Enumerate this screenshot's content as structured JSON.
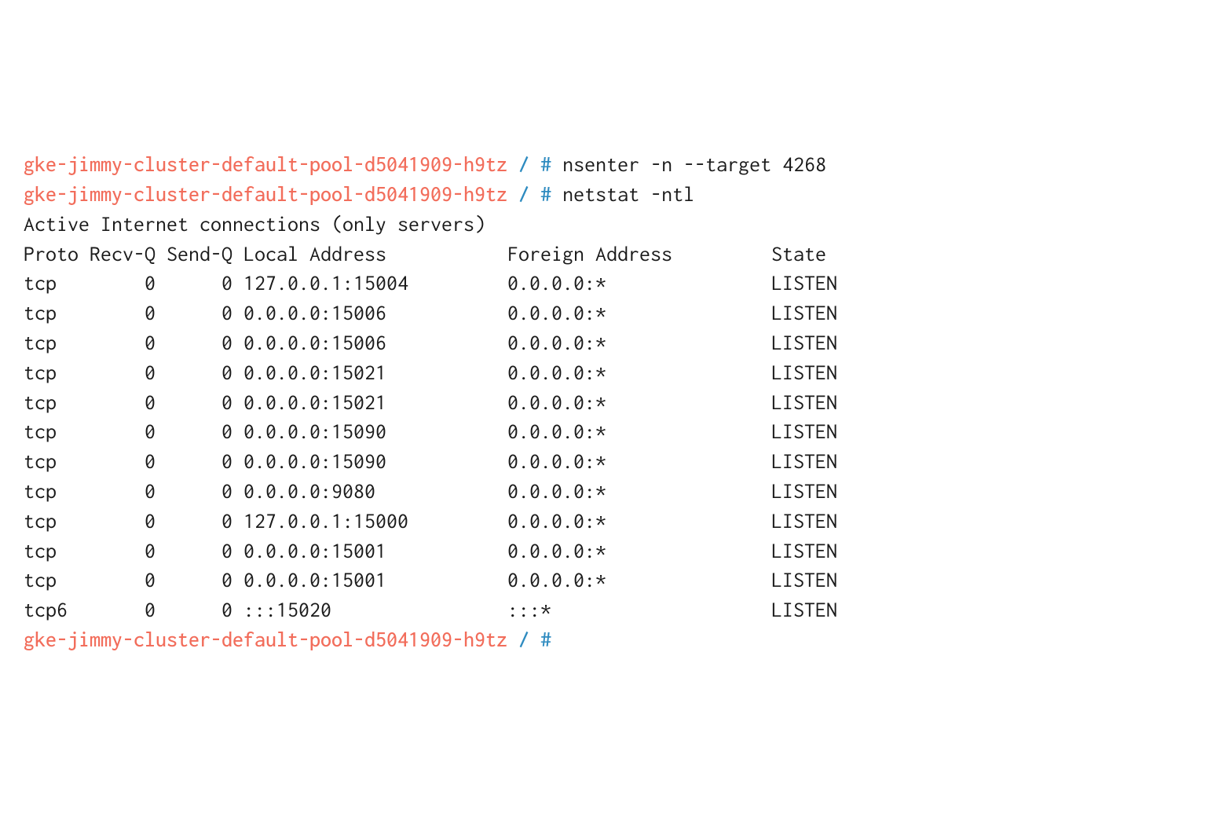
{
  "lines": [
    {
      "type": "prompt",
      "hostname": "gke-jimmy-cluster-default-pool-d5041909-h9tz",
      "path": "/",
      "hash": "#",
      "command": "nsenter -n --target 4268"
    },
    {
      "type": "prompt",
      "hostname": "gke-jimmy-cluster-default-pool-d5041909-h9tz",
      "path": "/",
      "hash": "#",
      "command": "netstat -ntl"
    },
    {
      "type": "output",
      "text": "Active Internet connections (only servers)"
    }
  ],
  "table": {
    "headers": [
      "Proto",
      "Recv-Q",
      "Send-Q",
      "Local Address",
      "Foreign Address",
      "State"
    ],
    "rows": [
      {
        "proto": "tcp",
        "recvq": "0",
        "sendq": "0",
        "local": "127.0.0.1:15004",
        "foreign": "0.0.0.0:*",
        "state": "LISTEN"
      },
      {
        "proto": "tcp",
        "recvq": "0",
        "sendq": "0",
        "local": "0.0.0.0:15006",
        "foreign": "0.0.0.0:*",
        "state": "LISTEN"
      },
      {
        "proto": "tcp",
        "recvq": "0",
        "sendq": "0",
        "local": "0.0.0.0:15006",
        "foreign": "0.0.0.0:*",
        "state": "LISTEN"
      },
      {
        "proto": "tcp",
        "recvq": "0",
        "sendq": "0",
        "local": "0.0.0.0:15021",
        "foreign": "0.0.0.0:*",
        "state": "LISTEN"
      },
      {
        "proto": "tcp",
        "recvq": "0",
        "sendq": "0",
        "local": "0.0.0.0:15021",
        "foreign": "0.0.0.0:*",
        "state": "LISTEN"
      },
      {
        "proto": "tcp",
        "recvq": "0",
        "sendq": "0",
        "local": "0.0.0.0:15090",
        "foreign": "0.0.0.0:*",
        "state": "LISTEN"
      },
      {
        "proto": "tcp",
        "recvq": "0",
        "sendq": "0",
        "local": "0.0.0.0:15090",
        "foreign": "0.0.0.0:*",
        "state": "LISTEN"
      },
      {
        "proto": "tcp",
        "recvq": "0",
        "sendq": "0",
        "local": "0.0.0.0:9080",
        "foreign": "0.0.0.0:*",
        "state": "LISTEN"
      },
      {
        "proto": "tcp",
        "recvq": "0",
        "sendq": "0",
        "local": "127.0.0.1:15000",
        "foreign": "0.0.0.0:*",
        "state": "LISTEN"
      },
      {
        "proto": "tcp",
        "recvq": "0",
        "sendq": "0",
        "local": "0.0.0.0:15001",
        "foreign": "0.0.0.0:*",
        "state": "LISTEN"
      },
      {
        "proto": "tcp",
        "recvq": "0",
        "sendq": "0",
        "local": "0.0.0.0:15001",
        "foreign": "0.0.0.0:*",
        "state": "LISTEN"
      },
      {
        "proto": "tcp6",
        "recvq": "0",
        "sendq": "0",
        "local": ":::15020",
        "foreign": ":::*",
        "state": "LISTEN"
      }
    ]
  },
  "final_prompt": {
    "hostname": "gke-jimmy-cluster-default-pool-d5041909-h9tz",
    "path": "/",
    "hash": "#",
    "command": ""
  },
  "col_widths": {
    "proto": 6,
    "recvq": 7,
    "sendq": 7,
    "local": 24,
    "foreign": 24
  }
}
